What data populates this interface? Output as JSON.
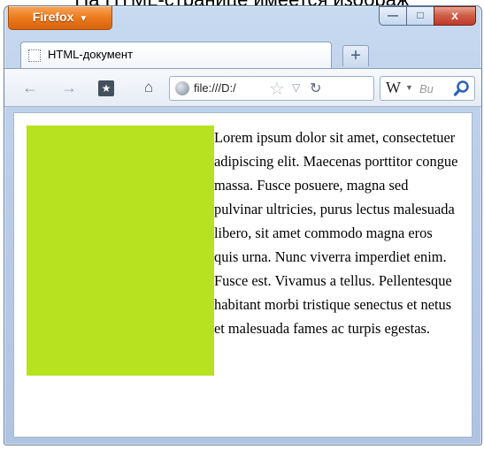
{
  "caption": "На HTML-странице имеется изображ",
  "window": {
    "menu_button_label": "Firefox",
    "min_label": "—",
    "max_label": "□",
    "close_label": "x"
  },
  "tab": {
    "title": "HTML-документ",
    "new_tab_label": "+"
  },
  "navbar": {
    "url": "file:///D:/",
    "search_engine": "W",
    "search_placeholder": "Bu"
  },
  "colors": {
    "box": "#b7e21f",
    "firefox_button": "#ec7a1c"
  },
  "content": {
    "paragraph": "Lorem ipsum dolor sit amet, consectetuer adipiscing elit. Maecenas porttitor congue massa. Fusce posuere, magna sed pulvinar ultricies, purus lectus malesuada libero, sit amet commodo magna eros quis urna. Nunc viverra imperdiet enim. Fusce est. Vivamus a tellus. Pellentesque habitant morbi tristique senectus et netus et malesuada fames ac turpis egestas."
  }
}
